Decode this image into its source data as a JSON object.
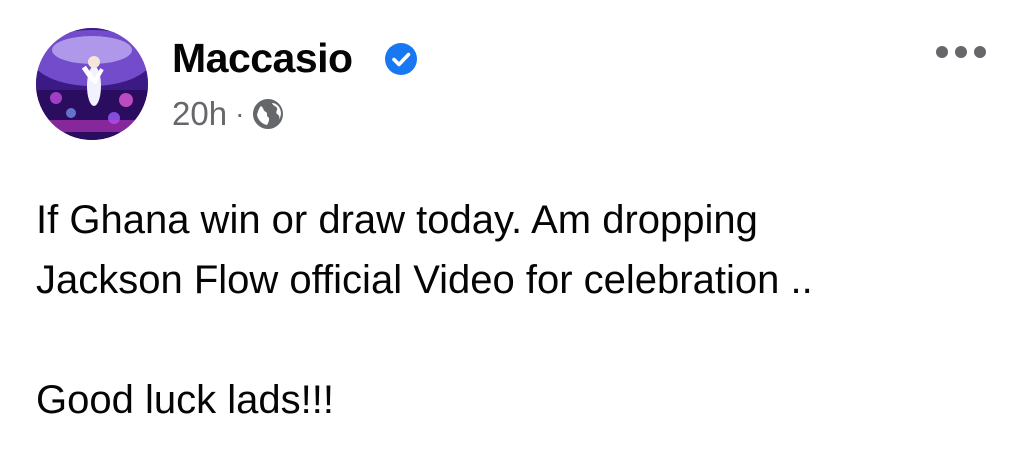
{
  "post": {
    "author": "Maccasio",
    "verified": true,
    "verified_color": "#1877F2",
    "timestamp": "20h",
    "separator": "·",
    "privacy_icon": "globe-icon",
    "more_icon": "more-options-icon",
    "body_lines": [
      "If Ghana win or draw today. Am dropping",
      "Jackson Flow official Video for celebration .."
    ],
    "closing_line": "Good luck lads!!!"
  }
}
